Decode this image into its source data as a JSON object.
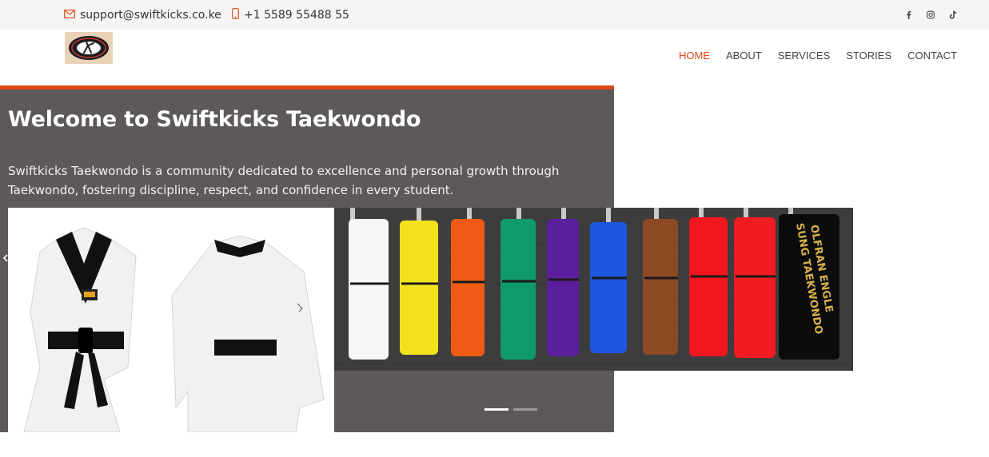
{
  "topbar": {
    "email": "support@swiftkicks.co.ke",
    "phone": "+1 5589 55488 55",
    "social_icons": [
      "facebook-icon",
      "instagram-icon",
      "tiktok-icon"
    ]
  },
  "nav": {
    "items": [
      {
        "label": "HOME",
        "active": true
      },
      {
        "label": "ABOUT",
        "active": false
      },
      {
        "label": "SERVICES",
        "active": false
      },
      {
        "label": "STORIES",
        "active": false
      },
      {
        "label": "CONTACT",
        "active": false
      }
    ]
  },
  "hero": {
    "title": "Welcome to Swiftkicks Taekwondo",
    "description": "Swiftkicks Taekwondo is a community dedicated to excellence and personal growth through Taekwondo, fostering discipline, respect, and confidence in every student.",
    "slides": 2,
    "active_slide": 1
  },
  "colors": {
    "accent": "#e04a16",
    "hero_bg": "#5d5958",
    "topbar_bg": "#f6f5f3"
  }
}
